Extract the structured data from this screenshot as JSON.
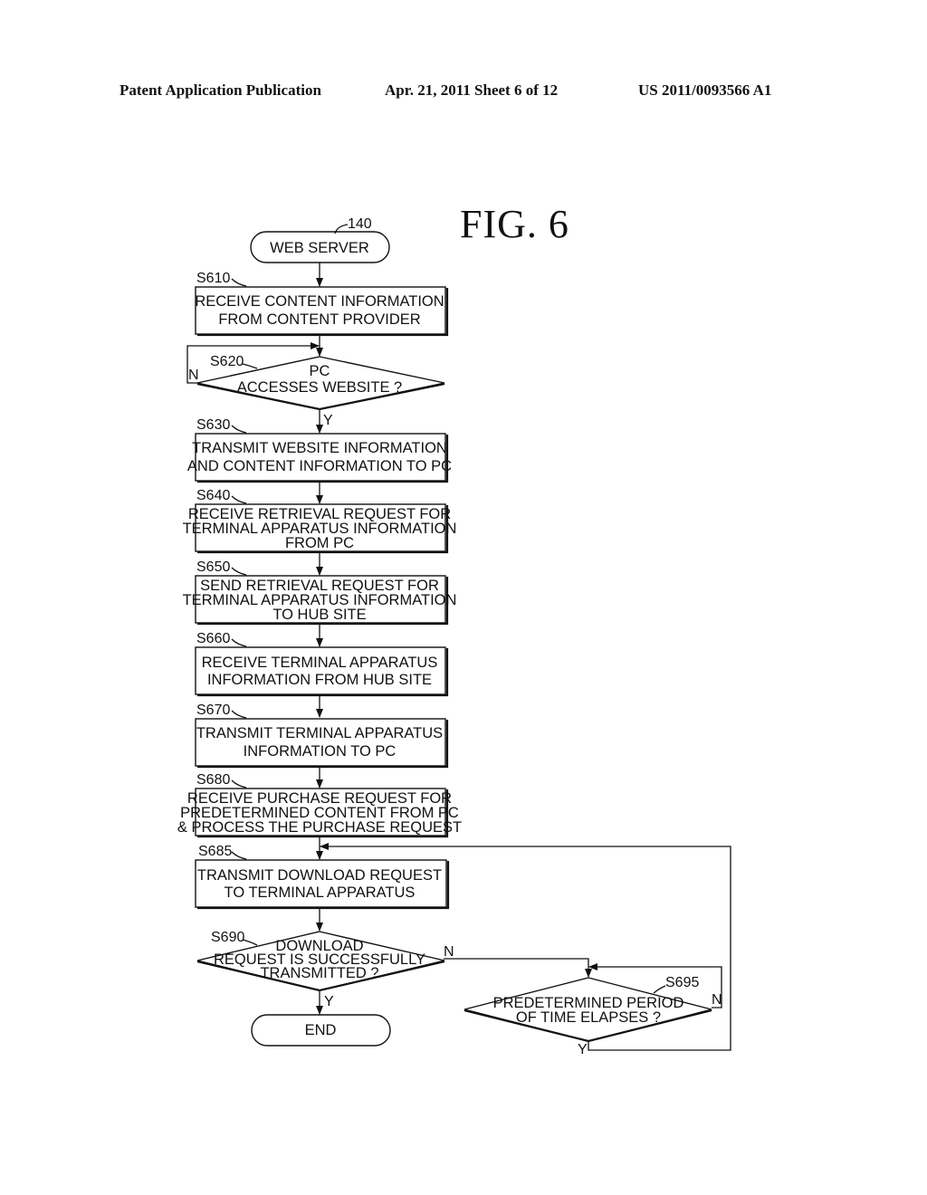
{
  "header": {
    "publication": "Patent Application Publication",
    "date_sheet": "Apr. 21, 2011  Sheet 6 of 12",
    "number": "US 2011/0093566 A1"
  },
  "figure": {
    "title": "FIG.  6",
    "start": {
      "ref": "140",
      "label": "WEB SERVER"
    },
    "end": {
      "label": "END"
    },
    "steps": [
      {
        "id": "S610",
        "type": "process",
        "lines": [
          "RECEIVE CONTENT INFORMATION",
          "FROM CONTENT PROVIDER"
        ]
      },
      {
        "id": "S620",
        "type": "decision",
        "lines": [
          "PC",
          "ACCESSES WEBSITE ?"
        ],
        "yes": "Y",
        "no": "N"
      },
      {
        "id": "S630",
        "type": "process",
        "lines": [
          "TRANSMIT WEBSITE INFORMATION",
          "AND CONTENT INFORMATION TO PC"
        ]
      },
      {
        "id": "S640",
        "type": "process",
        "lines": [
          "RECEIVE RETRIEVAL REQUEST FOR",
          "TERMINAL APPARATUS INFORMATION",
          "FROM PC"
        ]
      },
      {
        "id": "S650",
        "type": "process",
        "lines": [
          "SEND RETRIEVAL REQUEST FOR",
          "TERMINAL APPARATUS INFORMATION",
          "TO HUB SITE"
        ]
      },
      {
        "id": "S660",
        "type": "process",
        "lines": [
          "RECEIVE TERMINAL APPARATUS",
          "INFORMATION FROM HUB SITE"
        ]
      },
      {
        "id": "S670",
        "type": "process",
        "lines": [
          "TRANSMIT TERMINAL APPARATUS",
          "INFORMATION TO PC"
        ]
      },
      {
        "id": "S680",
        "type": "process",
        "lines": [
          "RECEIVE PURCHASE REQUEST FOR",
          "PREDETERMINED CONTENT FROM PC",
          "& PROCESS THE PURCHASE REQUEST"
        ]
      },
      {
        "id": "S685",
        "type": "process",
        "lines": [
          "TRANSMIT DOWNLOAD REQUEST",
          "TO TERMINAL APPARATUS"
        ]
      },
      {
        "id": "S690",
        "type": "decision",
        "lines": [
          "DOWNLOAD",
          "REQUEST IS SUCCESSFULLY",
          "TRANSMITTED ?"
        ],
        "yes": "Y",
        "no": "N"
      },
      {
        "id": "S695",
        "type": "decision",
        "lines": [
          "PREDETERMINED PERIOD",
          "OF TIME ELAPSES ?"
        ],
        "yes": "Y",
        "no": "N"
      }
    ]
  }
}
